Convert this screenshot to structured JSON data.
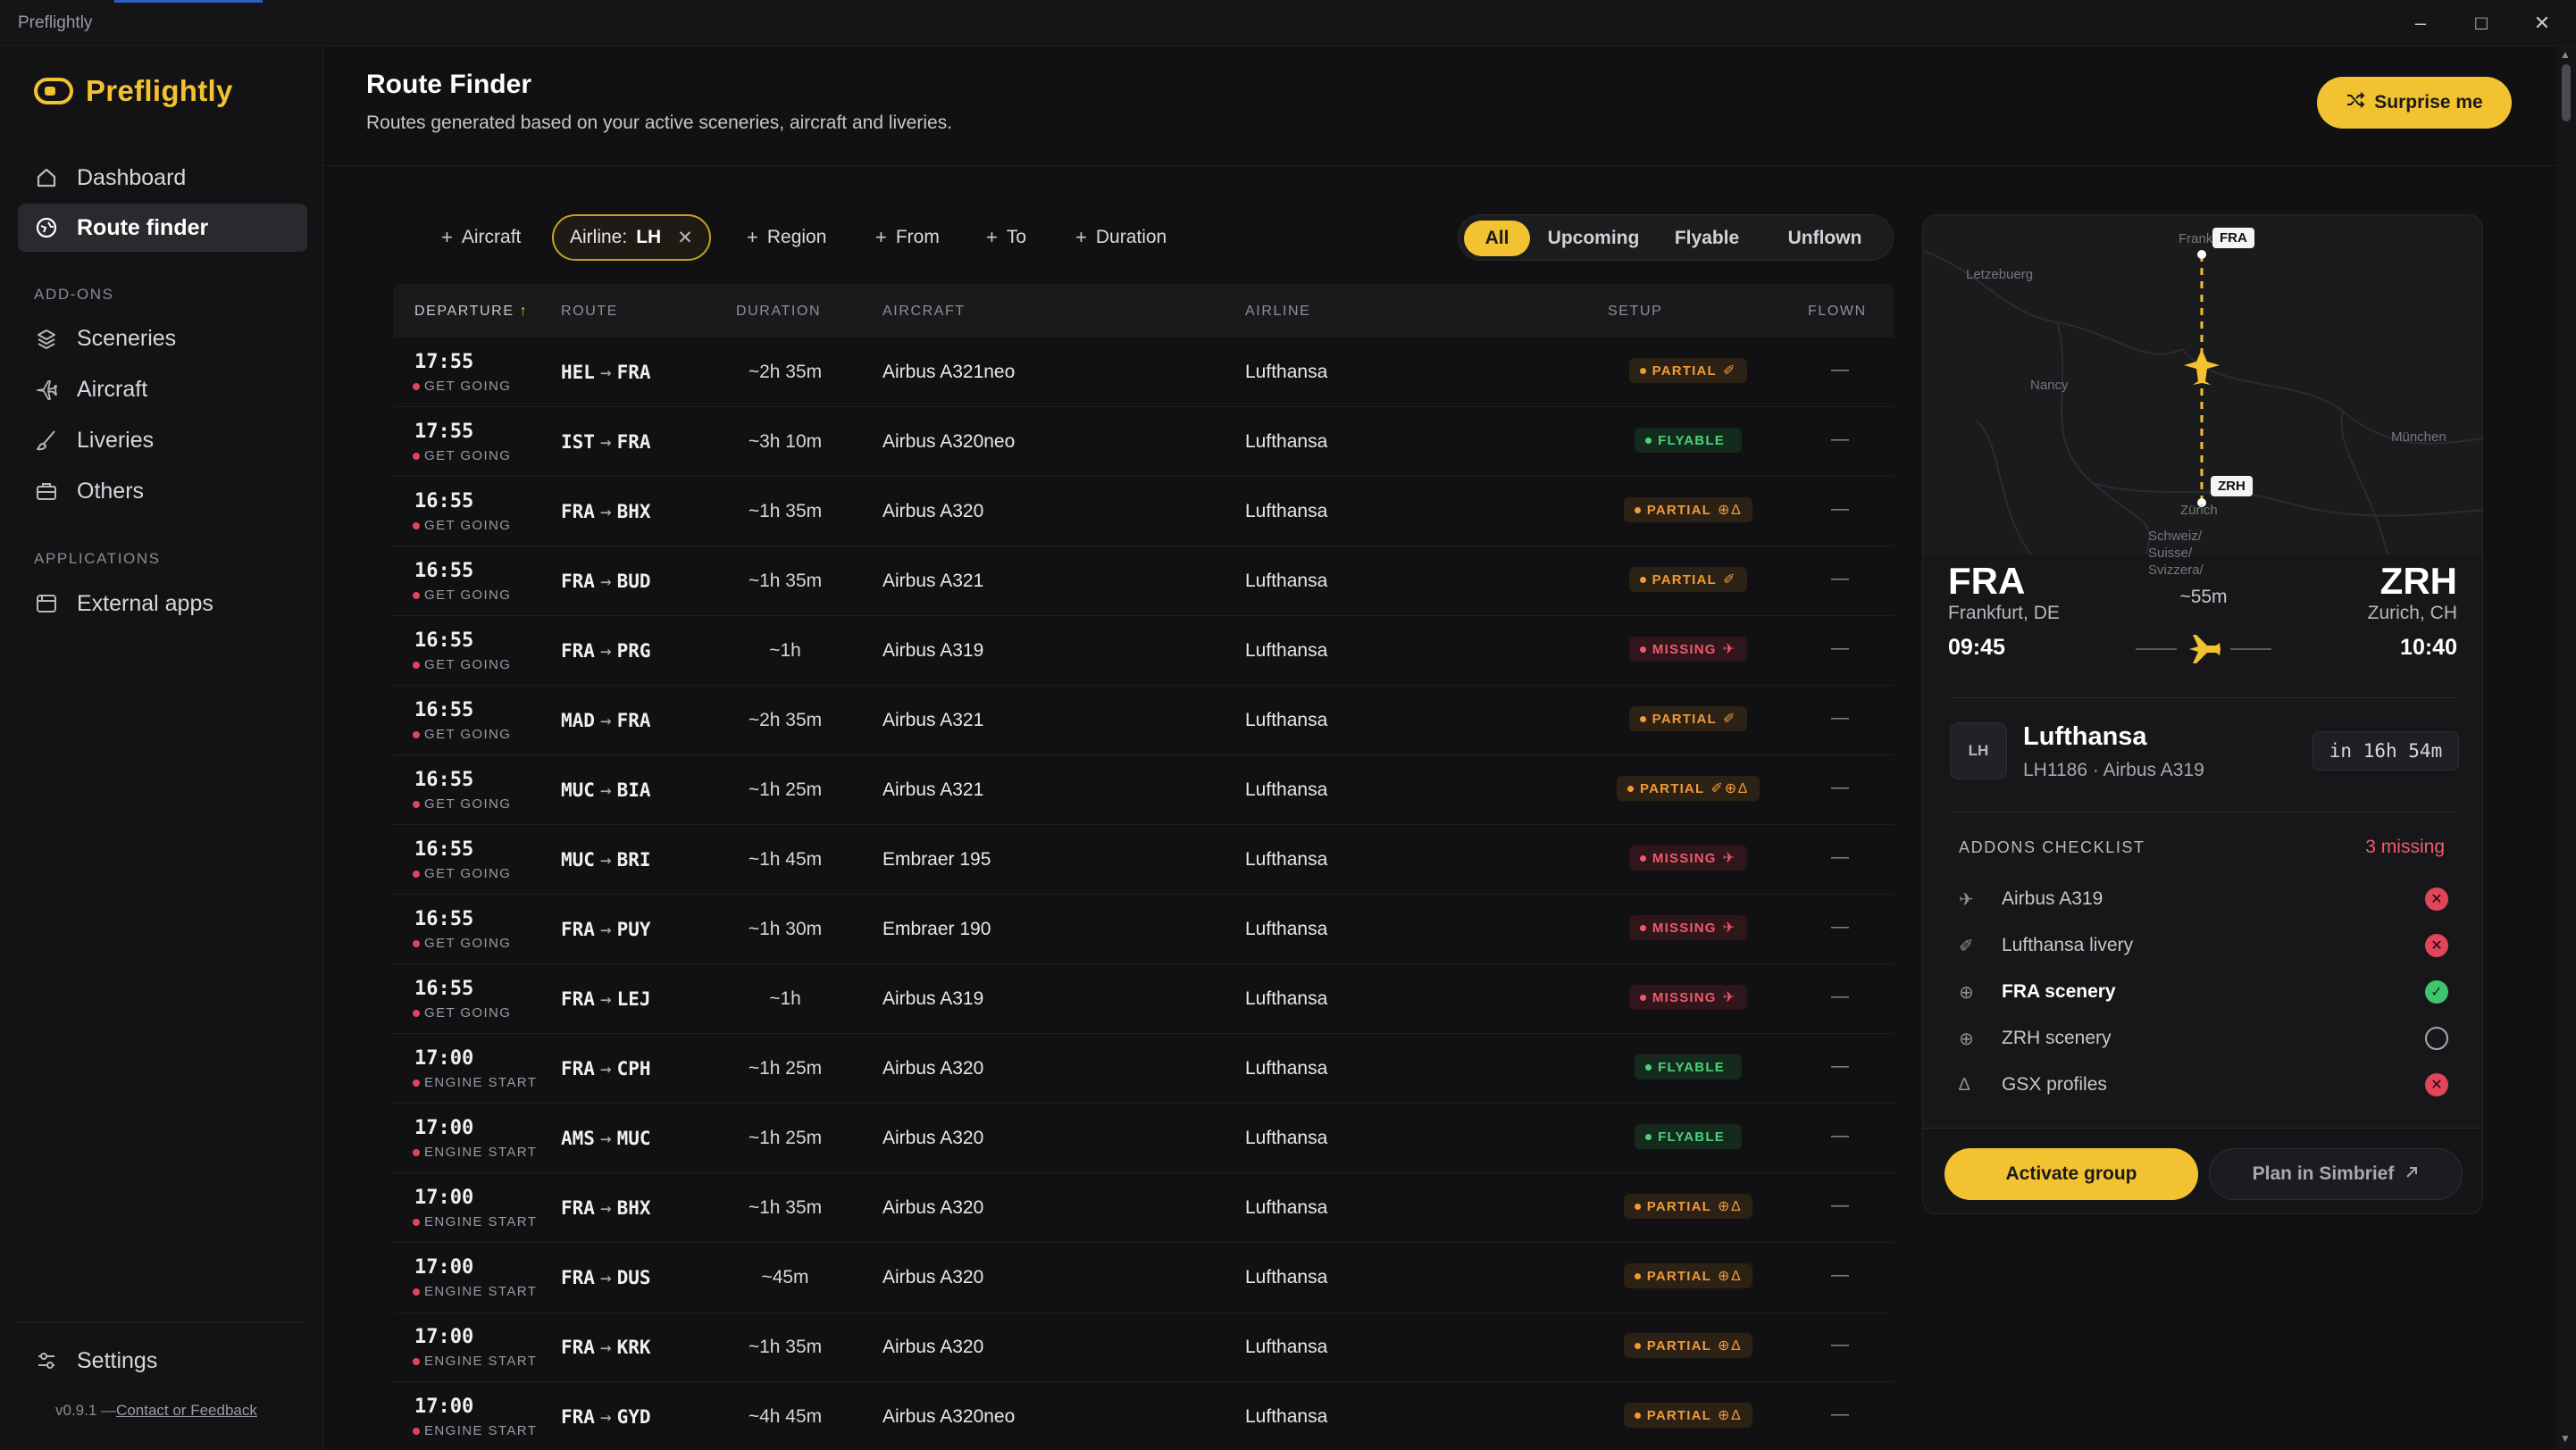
{
  "window": {
    "title": "Preflightly"
  },
  "sidebar": {
    "brand": "Preflightly",
    "nav": [
      {
        "label": "Dashboard",
        "icon": "home-icon"
      },
      {
        "label": "Route finder",
        "icon": "globe-icon",
        "active": true
      }
    ],
    "addons_title": "ADD-ONS",
    "addons": [
      {
        "label": "Sceneries",
        "icon": "scenery-icon"
      },
      {
        "label": "Aircraft",
        "icon": "plane-icon"
      },
      {
        "label": "Liveries",
        "icon": "brush-icon"
      },
      {
        "label": "Others",
        "icon": "briefcase-icon"
      }
    ],
    "applications_title": "APPLICATIONS",
    "applications": [
      {
        "label": "External apps",
        "icon": "apps-icon"
      }
    ],
    "settings": "Settings",
    "version": "v0.9.1 —",
    "feedback": "Contact or Feedback"
  },
  "header": {
    "title": "Route Finder",
    "subtitle": "Routes generated based on your active sceneries, aircraft and liveries.",
    "surprise": "Surprise me"
  },
  "filters": {
    "aircraft": "Aircraft",
    "airline_label": "Airline:",
    "airline_value": "LH",
    "region": "Region",
    "from": "From",
    "to": "To",
    "duration": "Duration"
  },
  "segments": [
    "All",
    "Upcoming",
    "Flyable",
    "Unflown"
  ],
  "table": {
    "columns": [
      "DEPARTURE",
      "ROUTE",
      "DURATION",
      "AIRCRAFT",
      "AIRLINE",
      "SETUP",
      "FLOWN"
    ],
    "rows": [
      {
        "time": "17:55",
        "status": "GET GOING",
        "from": "HEL",
        "to": "FRA",
        "duration": "~2h 35m",
        "aircraft": "Airbus A321neo",
        "airline": "Lufthansa",
        "setup": "PARTIAL",
        "setup_kind": "partial",
        "glyphs": "✐",
        "flown": "—"
      },
      {
        "time": "17:55",
        "status": "GET GOING",
        "from": "IST",
        "to": "FRA",
        "duration": "~3h 10m",
        "aircraft": "Airbus A320neo",
        "airline": "Lufthansa",
        "setup": "FLYABLE",
        "setup_kind": "flyable",
        "glyphs": "",
        "flown": "—"
      },
      {
        "time": "16:55",
        "status": "GET GOING",
        "from": "FRA",
        "to": "BHX",
        "duration": "~1h 35m",
        "aircraft": "Airbus A320",
        "airline": "Lufthansa",
        "setup": "PARTIAL",
        "setup_kind": "partial",
        "glyphs": "⊕∆",
        "flown": "—"
      },
      {
        "time": "16:55",
        "status": "GET GOING",
        "from": "FRA",
        "to": "BUD",
        "duration": "~1h 35m",
        "aircraft": "Airbus A321",
        "airline": "Lufthansa",
        "setup": "PARTIAL",
        "setup_kind": "partial",
        "glyphs": "✐",
        "flown": "—"
      },
      {
        "time": "16:55",
        "status": "GET GOING",
        "from": "FRA",
        "to": "PRG",
        "duration": "~1h",
        "aircraft": "Airbus A319",
        "airline": "Lufthansa",
        "setup": "MISSING",
        "setup_kind": "missing",
        "glyphs": "✈",
        "flown": "—"
      },
      {
        "time": "16:55",
        "status": "GET GOING",
        "from": "MAD",
        "to": "FRA",
        "duration": "~2h 35m",
        "aircraft": "Airbus A321",
        "airline": "Lufthansa",
        "setup": "PARTIAL",
        "setup_kind": "partial",
        "glyphs": "✐",
        "flown": "—"
      },
      {
        "time": "16:55",
        "status": "GET GOING",
        "from": "MUC",
        "to": "BIA",
        "duration": "~1h 25m",
        "aircraft": "Airbus A321",
        "airline": "Lufthansa",
        "setup": "PARTIAL",
        "setup_kind": "partial",
        "glyphs": "✐⊕∆",
        "flown": "—"
      },
      {
        "time": "16:55",
        "status": "GET GOING",
        "from": "MUC",
        "to": "BRI",
        "duration": "~1h 45m",
        "aircraft": "Embraer 195",
        "airline": "Lufthansa",
        "setup": "MISSING",
        "setup_kind": "missing",
        "glyphs": "✈",
        "flown": "—"
      },
      {
        "time": "16:55",
        "status": "GET GOING",
        "from": "FRA",
        "to": "PUY",
        "duration": "~1h 30m",
        "aircraft": "Embraer 190",
        "airline": "Lufthansa",
        "setup": "MISSING",
        "setup_kind": "missing",
        "glyphs": "✈",
        "flown": "—"
      },
      {
        "time": "16:55",
        "status": "GET GOING",
        "from": "FRA",
        "to": "LEJ",
        "duration": "~1h",
        "aircraft": "Airbus A319",
        "airline": "Lufthansa",
        "setup": "MISSING",
        "setup_kind": "missing",
        "glyphs": "✈",
        "flown": "—"
      },
      {
        "time": "17:00",
        "status": "ENGINE START",
        "from": "FRA",
        "to": "CPH",
        "duration": "~1h 25m",
        "aircraft": "Airbus A320",
        "airline": "Lufthansa",
        "setup": "FLYABLE",
        "setup_kind": "flyable",
        "glyphs": "",
        "flown": "—"
      },
      {
        "time": "17:00",
        "status": "ENGINE START",
        "from": "AMS",
        "to": "MUC",
        "duration": "~1h 25m",
        "aircraft": "Airbus A320",
        "airline": "Lufthansa",
        "setup": "FLYABLE",
        "setup_kind": "flyable",
        "glyphs": "",
        "flown": "—"
      },
      {
        "time": "17:00",
        "status": "ENGINE START",
        "from": "FRA",
        "to": "BHX",
        "duration": "~1h 35m",
        "aircraft": "Airbus A320",
        "airline": "Lufthansa",
        "setup": "PARTIAL",
        "setup_kind": "partial",
        "glyphs": "⊕∆",
        "flown": "—"
      },
      {
        "time": "17:00",
        "status": "ENGINE START",
        "from": "FRA",
        "to": "DUS",
        "duration": "~45m",
        "aircraft": "Airbus A320",
        "airline": "Lufthansa",
        "setup": "PARTIAL",
        "setup_kind": "partial",
        "glyphs": "⊕∆",
        "flown": "—"
      },
      {
        "time": "17:00",
        "status": "ENGINE START",
        "from": "FRA",
        "to": "KRK",
        "duration": "~1h 35m",
        "aircraft": "Airbus A320",
        "airline": "Lufthansa",
        "setup": "PARTIAL",
        "setup_kind": "partial",
        "glyphs": "⊕∆",
        "flown": "—"
      },
      {
        "time": "17:00",
        "status": "ENGINE START",
        "from": "FRA",
        "to": "GYD",
        "duration": "~4h 45m",
        "aircraft": "Airbus A320neo",
        "airline": "Lufthansa",
        "setup": "PARTIAL",
        "setup_kind": "partial",
        "glyphs": "⊕∆",
        "flown": "—"
      }
    ]
  },
  "details": {
    "map_labels": [
      "Letzebuerg",
      "Nancy",
      "München",
      "Schweiz/ Suisse/ Svizzera/",
      "Zürich",
      "Frankfurt am Main"
    ],
    "map_tag_from": "FRA",
    "map_tag_to": "ZRH",
    "from_code": "FRA",
    "from_city": "Frankfurt, DE",
    "from_time": "09:45",
    "to_code": "ZRH",
    "to_city": "Zurich, CH",
    "to_time": "10:40",
    "duration": "~55m",
    "airline_code": "LH",
    "airline_name": "Lufthansa",
    "airline_sub": "LH1186 · Airbus A319",
    "countdown": "in 16h 54m",
    "checklist_title": "ADDONS CHECKLIST",
    "checklist_missing": "3 missing",
    "checklist": [
      {
        "label": "Airbus A319",
        "icon": "plane-icon",
        "state": "missing"
      },
      {
        "label": "Lufthansa livery",
        "icon": "brush-icon",
        "state": "missing"
      },
      {
        "label": "FRA scenery",
        "icon": "scenery-icon",
        "state": "ok"
      },
      {
        "label": "ZRH scenery",
        "icon": "scenery-icon",
        "state": "pending"
      },
      {
        "label": "GSX profiles",
        "icon": "profile-icon",
        "state": "missing"
      }
    ],
    "activate": "Activate group",
    "plan": "Plan in Simbrief"
  }
}
